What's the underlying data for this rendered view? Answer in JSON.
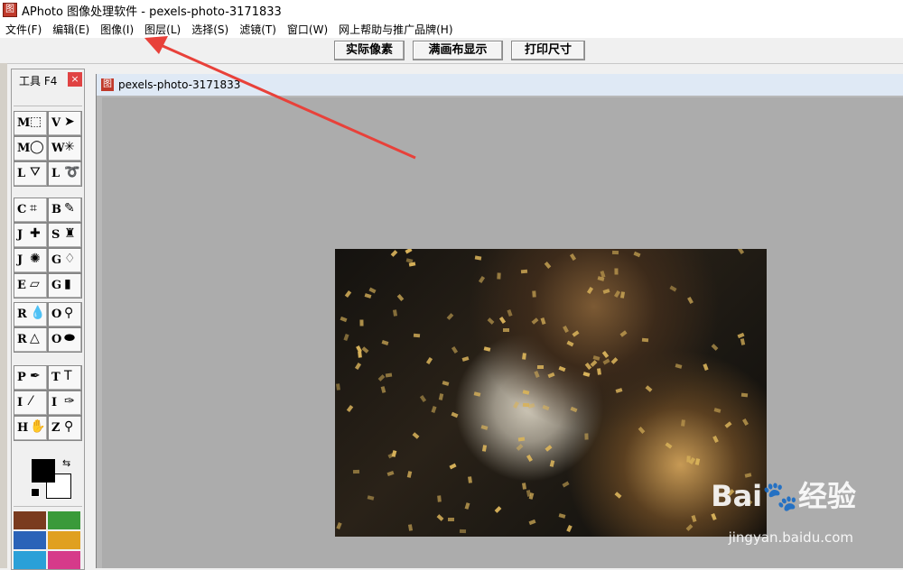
{
  "app": {
    "title": "APhoto 图像处理软件 - pexels-photo-3171833",
    "icon_glyph": "图"
  },
  "menubar": {
    "items": [
      "文件(F)",
      "编辑(E)",
      "图像(I)",
      "图层(L)",
      "选择(S)",
      "滤镜(T)",
      "窗口(W)",
      "网上帮助与推广品牌(H)"
    ]
  },
  "toolbar": {
    "buttons": [
      "实际像素",
      "满画布显示",
      "打印尺寸"
    ]
  },
  "tools_panel": {
    "title": "工具 F4",
    "close_glyph": "×",
    "tools": [
      {
        "key": "M",
        "glyph": "⬚",
        "icon": "rect-marquee-icon"
      },
      {
        "key": "V",
        "glyph": "➤",
        "icon": "move-icon"
      },
      {
        "key": "M",
        "glyph": "◯",
        "icon": "ellipse-marquee-icon"
      },
      {
        "key": "W",
        "glyph": "✳",
        "icon": "magic-wand-icon"
      },
      {
        "key": "L",
        "glyph": "⛛",
        "icon": "poly-lasso-icon"
      },
      {
        "key": "L",
        "glyph": "➰",
        "icon": "lasso-icon"
      },
      {
        "key": "C",
        "glyph": "⌗",
        "icon": "crop-icon"
      },
      {
        "key": "B",
        "glyph": "✎",
        "icon": "brush-icon"
      },
      {
        "key": "J",
        "glyph": "✚",
        "icon": "healing-icon"
      },
      {
        "key": "S",
        "glyph": "♜",
        "icon": "stamp-icon"
      },
      {
        "key": "J",
        "glyph": "✺",
        "icon": "spot-heal-icon"
      },
      {
        "key": "G",
        "glyph": "♢",
        "icon": "paint-bucket-icon"
      },
      {
        "key": "E",
        "glyph": "▱",
        "icon": "eraser-icon"
      },
      {
        "key": "G",
        "glyph": "▮",
        "icon": "gradient-icon"
      },
      {
        "key": "R",
        "glyph": "💧",
        "icon": "blur-icon"
      },
      {
        "key": "O",
        "glyph": "⚲",
        "icon": "dodge-icon"
      },
      {
        "key": "R",
        "glyph": "△",
        "icon": "sharpen-icon"
      },
      {
        "key": "O",
        "glyph": "⬬",
        "icon": "sponge-icon"
      },
      {
        "key": "P",
        "glyph": "✒",
        "icon": "pen-icon"
      },
      {
        "key": "T",
        "glyph": "T",
        "icon": "text-icon"
      },
      {
        "key": "I",
        "glyph": "⁄",
        "icon": "measure-icon"
      },
      {
        "key": "I",
        "glyph": "✑",
        "icon": "eyedropper-icon"
      },
      {
        "key": "H",
        "glyph": "✋",
        "icon": "hand-icon"
      },
      {
        "key": "Z",
        "glyph": "⚲",
        "icon": "zoom-icon"
      }
    ],
    "swap_glyph": "⇆"
  },
  "document": {
    "title": "pexels-photo-3171833",
    "icon_glyph": "图"
  },
  "watermark": {
    "brand": "Bai🐾经验",
    "url": "jingyan.baidu.com"
  },
  "colors": {
    "annotation_arrow": "#e8413a",
    "foreground": "#000000",
    "background": "#ffffff"
  }
}
